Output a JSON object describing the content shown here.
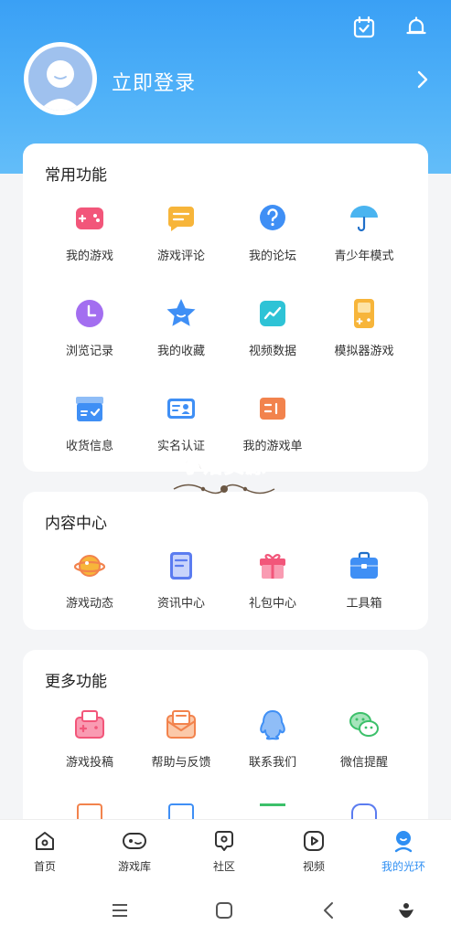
{
  "header": {
    "login_text": "立即登录",
    "icons": [
      "calendar-check-icon",
      "bell-icon",
      "chevron-right-icon"
    ]
  },
  "common": {
    "title": "常用功能",
    "items": [
      {
        "label": "我的游戏",
        "icon": "game-controller-icon",
        "color": "#f2567a"
      },
      {
        "label": "游戏评论",
        "icon": "comment-icon",
        "color": "#f7b53a"
      },
      {
        "label": "我的论坛",
        "icon": "question-icon",
        "color": "#3f8ff5"
      },
      {
        "label": "青少年模式",
        "icon": "umbrella-icon",
        "color": "#4ab4f0"
      },
      {
        "label": "浏览记录",
        "icon": "clock-icon",
        "color": "#a36ef0"
      },
      {
        "label": "我的收藏",
        "icon": "star-icon",
        "color": "#3f8ff5"
      },
      {
        "label": "视频数据",
        "icon": "chart-icon",
        "color": "#2ec3d6"
      },
      {
        "label": "模拟器游戏",
        "icon": "gameboy-icon",
        "color": "#f7b53a"
      },
      {
        "label": "收货信息",
        "icon": "box-icon",
        "color": "#3f8ff5"
      },
      {
        "label": "实名认证",
        "icon": "id-card-icon",
        "color": "#3f8ff5"
      },
      {
        "label": "我的游戏单",
        "icon": "ticket-icon",
        "color": "#f2834d"
      }
    ]
  },
  "content": {
    "title": "内容中心",
    "items": [
      {
        "label": "游戏动态",
        "icon": "planet-icon",
        "color": "#f2834d"
      },
      {
        "label": "资讯中心",
        "icon": "document-icon",
        "color": "#5b7cf0"
      },
      {
        "label": "礼包中心",
        "icon": "gift-icon",
        "color": "#f2567a"
      },
      {
        "label": "工具箱",
        "icon": "toolbox-icon",
        "color": "#3f8ff5"
      }
    ]
  },
  "more": {
    "title": "更多功能",
    "items": [
      {
        "label": "游戏投稿",
        "icon": "game-upload-icon",
        "color": "#f2567a"
      },
      {
        "label": "帮助与反馈",
        "icon": "mail-icon",
        "color": "#f2834d"
      },
      {
        "label": "联系我们",
        "icon": "qq-icon",
        "color": "#3f8ff5"
      },
      {
        "label": "微信提醒",
        "icon": "wechat-icon",
        "color": "#3cc06a"
      }
    ]
  },
  "watermark": {
    "text": "小落资源"
  },
  "tabbar": {
    "items": [
      {
        "label": "首页",
        "icon": "home-icon",
        "active": false
      },
      {
        "label": "游戏库",
        "icon": "gamepad-icon",
        "active": false
      },
      {
        "label": "社区",
        "icon": "community-icon",
        "active": false
      },
      {
        "label": "视频",
        "icon": "video-icon",
        "active": false
      },
      {
        "label": "我的光环",
        "icon": "profile-icon",
        "active": true
      }
    ],
    "active_color": "#2f8ff3"
  },
  "system_nav": {
    "icons": [
      "menu-icon",
      "home-square-icon",
      "back-icon",
      "assistant-icon"
    ]
  }
}
